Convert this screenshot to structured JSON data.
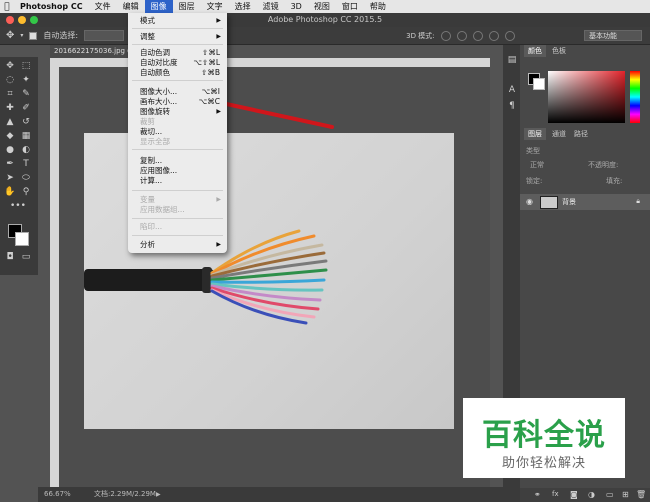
{
  "menubar": {
    "items": [
      "Photoshop CC",
      "文件",
      "编辑",
      "图像",
      "图层",
      "文字",
      "选择",
      "滤镜",
      "3D",
      "视图",
      "窗口",
      "帮助"
    ],
    "active_index": 3
  },
  "window": {
    "title": "Adobe Photoshop CC 2015.5"
  },
  "optionsbar": {
    "auto_select": "自动选择:",
    "mode_3d": "3D 模式:",
    "workspace": "基本功能"
  },
  "document": {
    "tab": "20166221750​36.jpg @",
    "zoom": "66.67%",
    "doc_info": "文档:2.29M/2.29M"
  },
  "image_menu": {
    "items": [
      {
        "label": "模式",
        "submenu": true
      },
      {
        "label": "调整",
        "submenu": true
      },
      {
        "label": "自动色调",
        "shortcut": "⇧⌘L"
      },
      {
        "label": "自动对比度",
        "shortcut": "⌥⇧⌘L"
      },
      {
        "label": "自动颜色",
        "shortcut": "⇧⌘B"
      },
      {
        "label": "图像大小...",
        "shortcut": "⌥⌘I"
      },
      {
        "label": "画布大小...",
        "shortcut": "⌥⌘C"
      },
      {
        "label": "图像旋转",
        "submenu": true
      },
      {
        "label": "裁剪",
        "disabled": true
      },
      {
        "label": "裁切..."
      },
      {
        "label": "显示全部",
        "disabled": true
      },
      {
        "label": "复制..."
      },
      {
        "label": "应用图像..."
      },
      {
        "label": "计算..."
      },
      {
        "label": "变量",
        "submenu": true,
        "disabled": true
      },
      {
        "label": "应用数据组...",
        "disabled": true
      },
      {
        "label": "陷印...",
        "disabled": true
      },
      {
        "label": "分析",
        "submenu": true
      }
    ]
  },
  "color_panel": {
    "tabs": [
      "颜色",
      "色板"
    ]
  },
  "layers_panel": {
    "tabs": [
      "图层",
      "通道",
      "路径"
    ],
    "kind": "类型",
    "blend": "正常",
    "opacity_label": "不透明度:",
    "lock_label": "锁定:",
    "fill_label": "填充:",
    "layer_name": "背景"
  },
  "watermark": {
    "title": "百科全说",
    "subtitle": "助你轻松解决"
  },
  "colors": {
    "menu_highlight": "#2e63c9",
    "arrow": "#d0161b",
    "watermark_green": "#2aa04a"
  }
}
